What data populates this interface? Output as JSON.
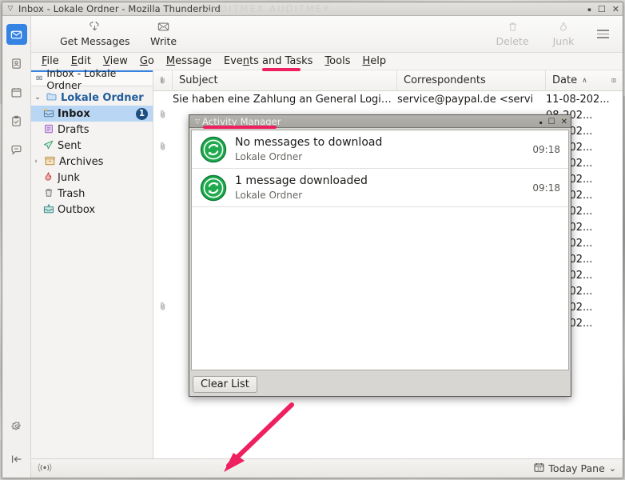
{
  "window": {
    "title": "Inbox - Lokale Ordner - Mozilla Thunderbird",
    "ghost_text": "AUDITMEX      AUDITMEX",
    "menu_glyph": "▽",
    "controls": {
      "minimize": "▪",
      "maximize": "☐",
      "close": "✕"
    }
  },
  "rail": {
    "items": [
      {
        "name": "mail",
        "glyph": "✉",
        "active": true
      },
      {
        "name": "address-book",
        "glyph": "▣",
        "active": false
      },
      {
        "name": "calendar",
        "glyph": "▦",
        "active": false
      },
      {
        "name": "tasks",
        "glyph": "☑",
        "active": false
      },
      {
        "name": "chat",
        "glyph": "💬",
        "active": false
      }
    ],
    "bottom": [
      {
        "name": "settings",
        "glyph": "⚙"
      },
      {
        "name": "collapse",
        "glyph": "|←"
      }
    ]
  },
  "toolbar": {
    "get_messages": {
      "label": "Get Messages",
      "icon": "▽",
      "disabled": false
    },
    "write": {
      "label": "Write",
      "icon": "✉",
      "disabled": false
    },
    "delete": {
      "label": "Delete",
      "icon": "🗑",
      "disabled": true
    },
    "junk": {
      "label": "Junk",
      "icon": "🔥",
      "disabled": true
    },
    "app_menu": "app-menu-button"
  },
  "menubar": {
    "items": [
      {
        "label": "File",
        "mnemonic": "F"
      },
      {
        "label": "Edit",
        "mnemonic": "E"
      },
      {
        "label": "View",
        "mnemonic": "V"
      },
      {
        "label": "Go",
        "mnemonic": "G"
      },
      {
        "label": "Message",
        "mnemonic": "M"
      },
      {
        "label": "Events and Tasks",
        "mnemonic": "n"
      },
      {
        "label": "Tools",
        "mnemonic": "T"
      },
      {
        "label": "Help",
        "mnemonic": "H"
      }
    ]
  },
  "folder_pane": {
    "tab_label": "Inbox - Lokale Ordner",
    "tab_icon": "✉",
    "items": [
      {
        "label": "Lokale Ordner",
        "icon": "🗀",
        "twisty": "⌄",
        "level": 0,
        "selected": false,
        "badge": ""
      },
      {
        "label": "Inbox",
        "icon": "📥",
        "twisty": "",
        "level": 1,
        "selected": true,
        "badge": "1"
      },
      {
        "label": "Drafts",
        "icon": "📝",
        "twisty": "",
        "level": 1,
        "selected": false,
        "badge": ""
      },
      {
        "label": "Sent",
        "icon": "➤",
        "twisty": "",
        "level": 1,
        "selected": false,
        "badge": ""
      },
      {
        "label": "Archives",
        "icon": "🗃",
        "twisty": "›",
        "level": 1,
        "selected": false,
        "badge": ""
      },
      {
        "label": "Junk",
        "icon": "🔥",
        "twisty": "",
        "level": 1,
        "selected": false,
        "badge": ""
      },
      {
        "label": "Trash",
        "icon": "🗑",
        "twisty": "",
        "level": 1,
        "selected": false,
        "badge": ""
      },
      {
        "label": "Outbox",
        "icon": "📤",
        "twisty": "",
        "level": 1,
        "selected": false,
        "badge": ""
      }
    ]
  },
  "message_list": {
    "columns": {
      "attachment": "📎",
      "subject": "Subject",
      "correspondents": "Correspondents",
      "date": "Date",
      "sort_arrow": "∧",
      "column_picker": "▥"
    },
    "rows": [
      {
        "attach": "",
        "subject": "Sie haben eine Zahlung an General Logistic",
        "correspondents": "service@paypal.de <servi",
        "date": "11-08-202..."
      },
      {
        "attach": "📎",
        "subject": "",
        "correspondents": "",
        "date": "08-202..."
      },
      {
        "attach": "",
        "subject": "",
        "correspondents": "",
        "date": "08-202..."
      },
      {
        "attach": "📎",
        "subject": "",
        "correspondents": "",
        "date": "08-202..."
      },
      {
        "attach": "",
        "subject": "",
        "correspondents": "",
        "date": "08-202..."
      },
      {
        "attach": "",
        "subject": "",
        "correspondents": "",
        "date": "08-202..."
      },
      {
        "attach": "",
        "subject": "",
        "correspondents": "",
        "date": "08-202..."
      },
      {
        "attach": "",
        "subject": "",
        "correspondents": "",
        "date": "08-202..."
      },
      {
        "attach": "",
        "subject": "",
        "correspondents": "",
        "date": "08-202..."
      },
      {
        "attach": "",
        "subject": "",
        "correspondents": "",
        "date": "08-202..."
      },
      {
        "attach": "",
        "subject": "",
        "correspondents": "",
        "date": "08-202..."
      },
      {
        "attach": "",
        "subject": "",
        "correspondents": "",
        "date": "08-202..."
      },
      {
        "attach": "",
        "subject": "",
        "correspondents": "",
        "date": "08-202..."
      },
      {
        "attach": "📎",
        "subject": "",
        "correspondents": "",
        "date": "08-202..."
      },
      {
        "attach": "",
        "subject": "",
        "correspondents": "",
        "date": "07-202..."
      }
    ]
  },
  "statusbar": {
    "connection_icon": "((•))",
    "today_pane": {
      "label": "Today Pane",
      "icon": "📅",
      "chevron": "⌄"
    }
  },
  "activity_manager": {
    "title": "Activity Manager",
    "menu_glyph": "▽",
    "controls": {
      "minimize": "▪",
      "maximize": "☐",
      "close": "✕"
    },
    "items": [
      {
        "icon": "sync-icon",
        "headline": "No messages to download",
        "source": "Lokale Ordner",
        "time": "09:18"
      },
      {
        "icon": "sync-icon",
        "headline": "1 message downloaded",
        "source": "Lokale Ordner",
        "time": "09:18"
      }
    ],
    "clear_list_label": "Clear List"
  },
  "annotations": {
    "color": "#ef2060",
    "marks": [
      {
        "name": "tools-underline",
        "kind": "underline"
      },
      {
        "name": "activity-manager-underline",
        "kind": "underline"
      },
      {
        "name": "pointer-arrow",
        "kind": "arrow"
      }
    ]
  }
}
